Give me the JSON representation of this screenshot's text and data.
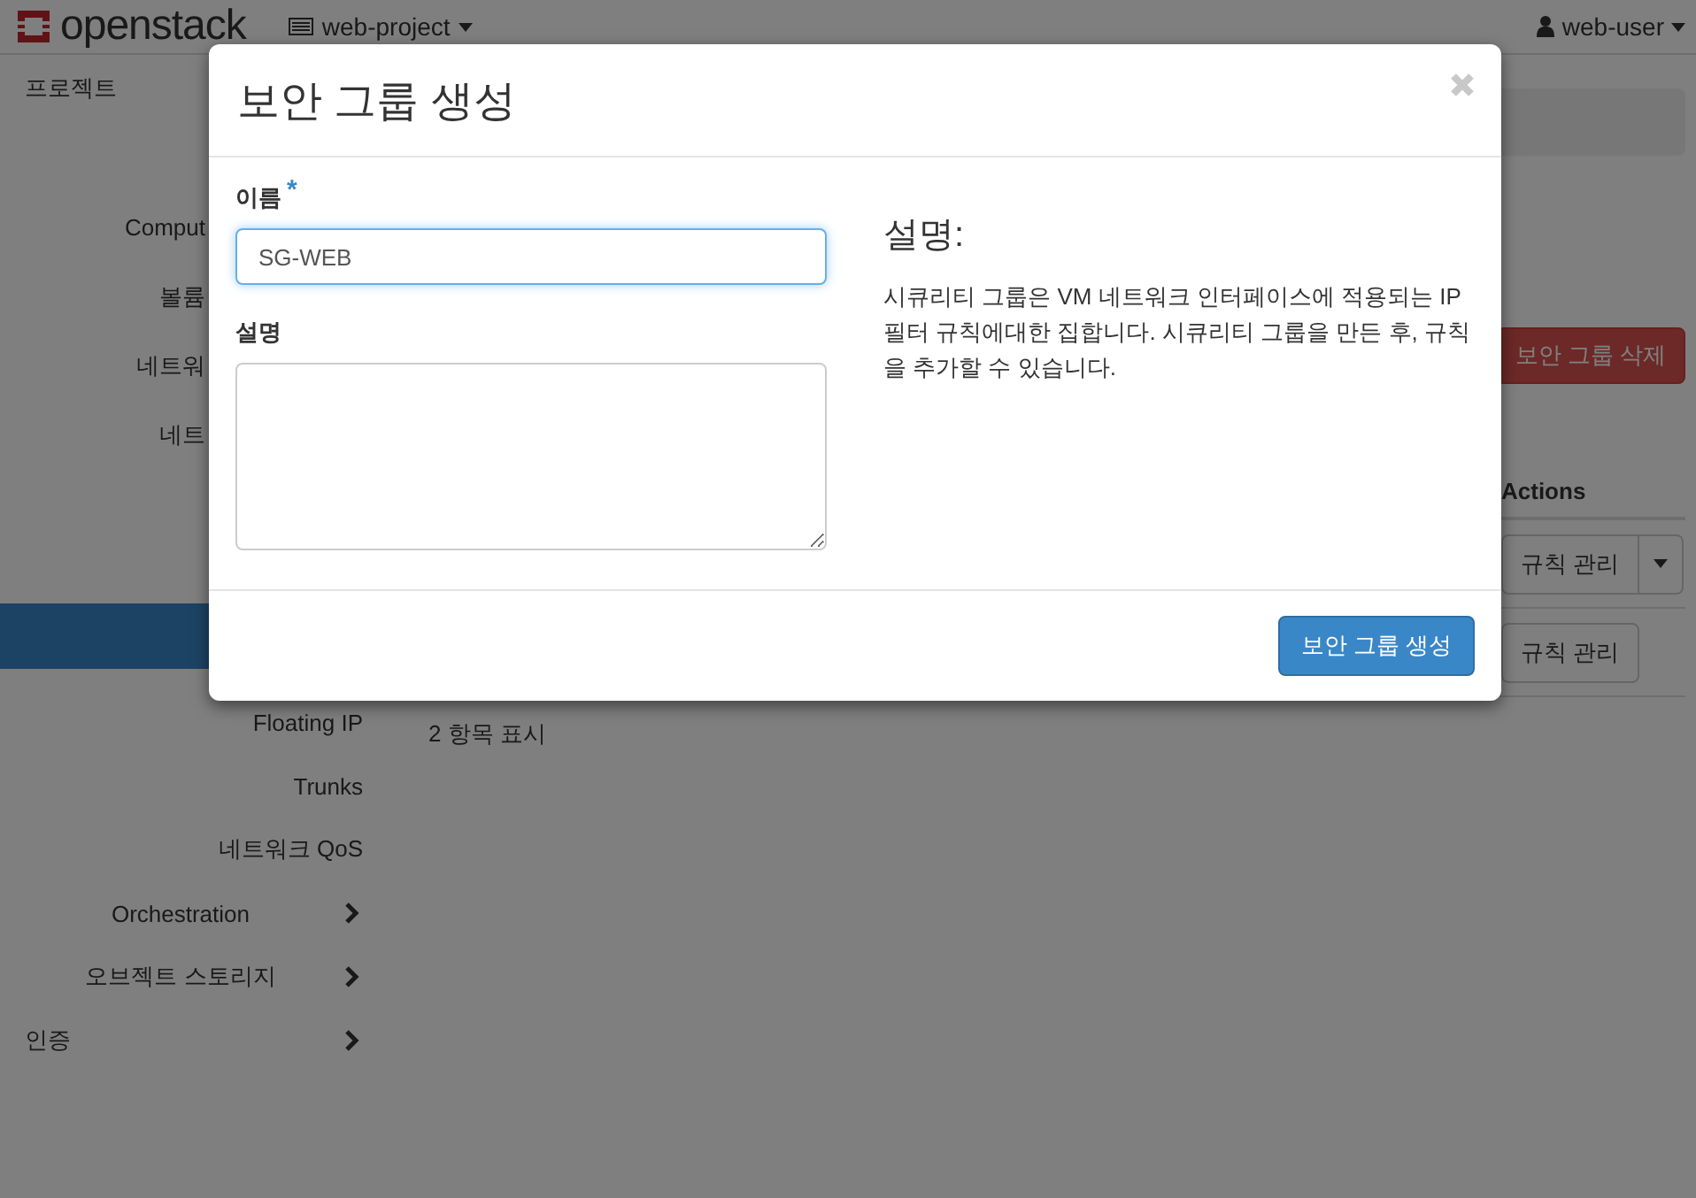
{
  "topbar": {
    "logo": "openstack",
    "project": "web-project",
    "user": "web-user"
  },
  "sidebar": {
    "heading": "프로젝트",
    "covered_items": [
      "Comput",
      "볼륨",
      "네트워",
      "네트"
    ],
    "items": [
      {
        "label": "Floating IP",
        "kind": "link"
      },
      {
        "label": "Trunks",
        "kind": "link"
      },
      {
        "label": "네트워크 QoS",
        "kind": "link"
      },
      {
        "label": "Orchestration",
        "kind": "group"
      },
      {
        "label": "오브젝트 스토리지",
        "kind": "group"
      },
      {
        "label": "인증",
        "kind": "section"
      }
    ]
  },
  "main": {
    "delete_button": "보안 그룹 삭제",
    "table": {
      "actions_header": "Actions",
      "rows": [
        {
          "action": "규칙 관리",
          "kind": "split"
        },
        {
          "action": "규칙 관리",
          "kind": "plain"
        }
      ]
    },
    "count": "2 항목 표시"
  },
  "modal": {
    "title": "보안 그룹 생성",
    "fields": [
      {
        "label": "이름",
        "required_mark": "*",
        "kind": "input",
        "value": "SG-WEB",
        "focused": true
      },
      {
        "label": "설명",
        "kind": "textarea",
        "focused": false
      }
    ],
    "help_title": "설명:",
    "help_text": "시큐리티 그룹은 VM 네트워크 인터페이스에 적용되는 IP 필터 규칙에대한 집합니다. 시큐리티 그룹을 만든 후, 규칙을 추가할 수 있습니다.",
    "submit": "보안 그룹 생성"
  }
}
